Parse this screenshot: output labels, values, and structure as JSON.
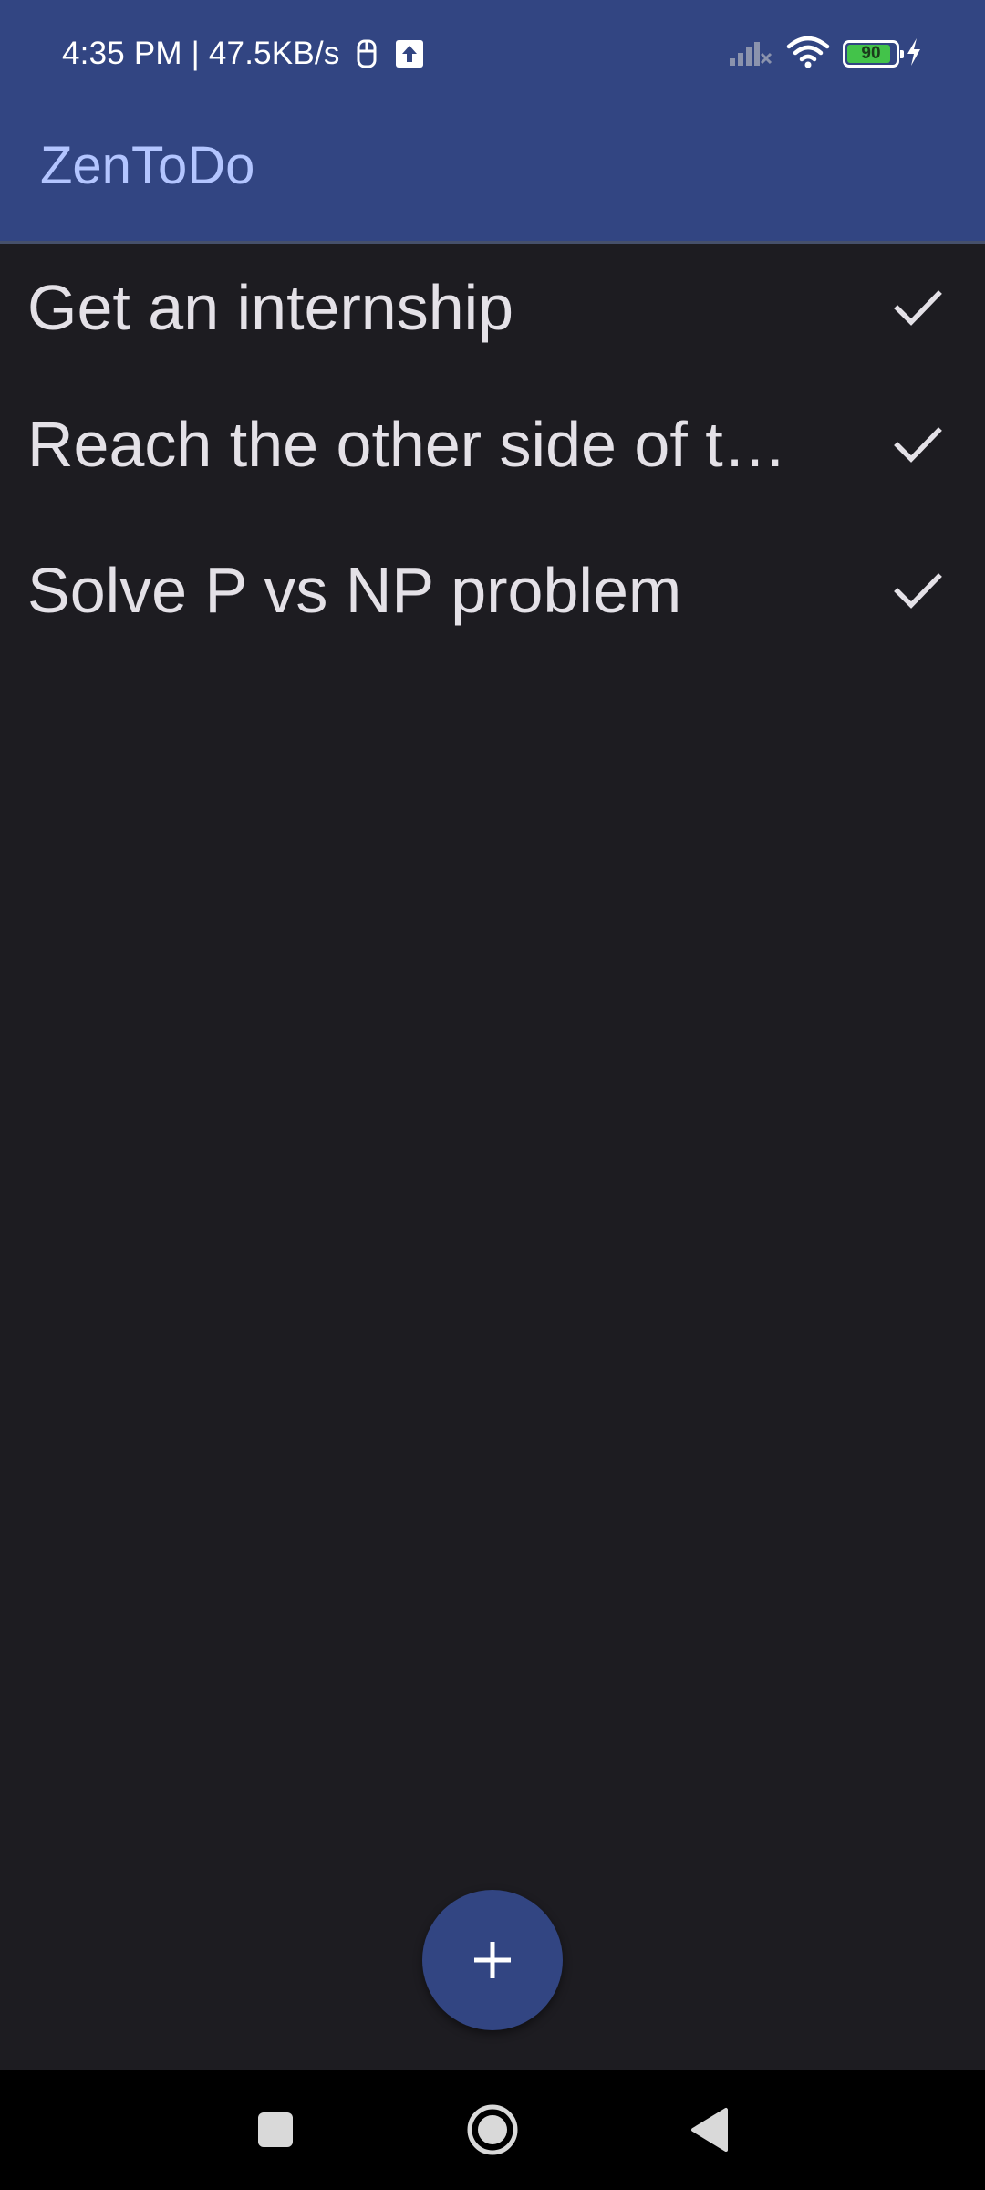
{
  "status_bar": {
    "time_net": "4:35 PM | 47.5KB/s",
    "battery_level": "90",
    "battery_fraction": 0.9,
    "icons": [
      "screenshot-icon",
      "upload-icon",
      "signal-icon",
      "wifi-icon",
      "battery-icon",
      "charging-icon"
    ]
  },
  "app_bar": {
    "title": "ZenToDo"
  },
  "todos": [
    {
      "text": "Get an internship",
      "action_icon": "check-icon"
    },
    {
      "text": "Reach the other side of the galaxy",
      "action_icon": "check-icon"
    },
    {
      "text": "Solve P vs NP problem",
      "action_icon": "check-icon"
    }
  ],
  "fab": {
    "icon": "plus-icon"
  },
  "nav_bar": {
    "buttons": [
      "recents-button",
      "home-button",
      "back-button"
    ]
  },
  "colors": {
    "primary": "#324582",
    "background": "#1d1c21",
    "title": "#b3c5ff",
    "text": "#e4e1e7",
    "battery": "#43c34a"
  }
}
